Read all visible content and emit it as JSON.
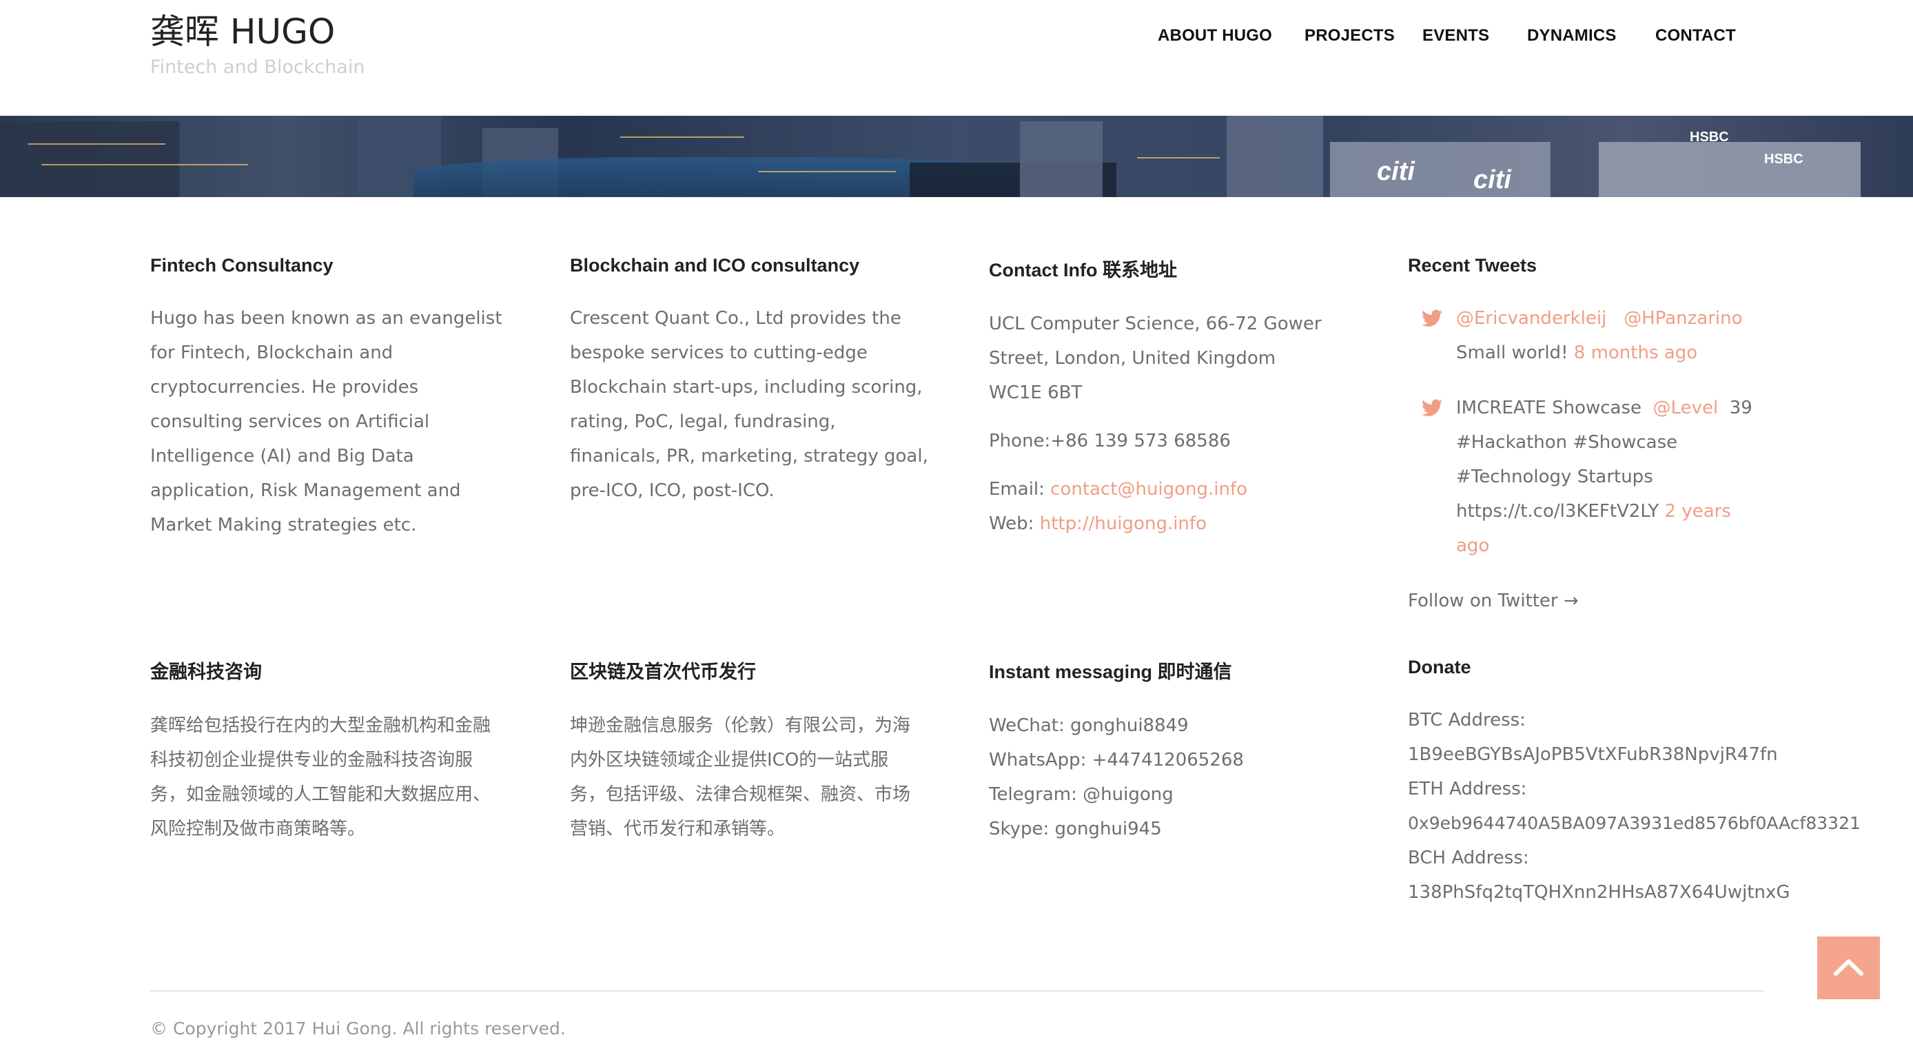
{
  "site": {
    "title": "龚晖 HUGO",
    "tagline": "Fintech and Blockchain"
  },
  "nav": {
    "items": [
      "ABOUT HUGO",
      "PROJECTS",
      "EVENTS",
      "DYNAMICS",
      "CONTACT"
    ]
  },
  "hero": {
    "signs": [
      "citi",
      "citi",
      "HSBC",
      "HSBC"
    ]
  },
  "fintech": {
    "heading": "Fintech Consultancy",
    "body": "Hugo has been known as an evangelist for Fintech, Blockchain and cryptocurrencies. He provides consulting services on Artificial Intelligence (AI) and Big Data application, Risk Management and Market Making strategies etc."
  },
  "blockchain": {
    "heading": "Blockchain and ICO consultancy",
    "body": "Crescent Quant Co., Ltd provides the bespoke services to cutting-edge Blockchain start-ups, including scoring, rating, PoC, legal, fundrasing, finanicals, PR, marketing, strategy goal, pre-ICO, ICO, post-ICO."
  },
  "contact": {
    "heading": "Contact Info 联系地址",
    "address": "UCL Computer Science, 66-72 Gower Street, London, United Kingdom WC1E 6BT",
    "phone": "Phone:+86 139 573 68586",
    "email_label": "Email: ",
    "email": "contact@huigong.info",
    "web_label": "Web: ",
    "web": "http://huigong.info"
  },
  "tweets": {
    "heading": "Recent Tweets",
    "items": [
      {
        "mention1": "@Ericvanderkleij",
        "mention2": "@HPanzarino",
        "text": "Small world!",
        "time": "8 months ago"
      },
      {
        "pre": "IMCREATE Showcase",
        "mention": "@Level",
        "text": "39 #Hackathon #Showcase #Technology Startups https://t.co/l3KEFtV2LY",
        "time": "2 years ago"
      }
    ],
    "follow": "Follow on Twitter →"
  },
  "fintech_cn": {
    "heading": "金融科技咨询",
    "body": "龚晖给包括投行在内的大型金融机构和金融科技初创企业提供专业的金融科技咨询服务，如金融领域的人工智能和大数据应用、风险控制及做市商策略等。"
  },
  "blockchain_cn": {
    "heading": "区块链及首次代币发行",
    "body": "坤逊金融信息服务（伦敦）有限公司，为海内外区块链领域企业提供ICO的一站式服务，包括评级、法律合规框架、融资、市场营销、代币发行和承销等。"
  },
  "im": {
    "heading": "Instant messaging 即时通信",
    "items": [
      "WeChat: gonghui8849",
      "WhatsApp: +447412065268",
      "Telegram: @huigong",
      "Skype: gonghui945"
    ]
  },
  "donate": {
    "heading": "Donate",
    "btc_label": "BTC Address:",
    "btc": "1B9eeBGYBsAJoPB5VtXFubR38NpvjR47fn",
    "eth_label": "ETH Address:",
    "eth": "0x9eb9644740A5BA097A3931ed8576bf0AAcf83321",
    "bch_label": "BCH Address:",
    "bch": "138PhSfq2tqTQHXnn2HHsA87X64UwjtnxG"
  },
  "footer": {
    "copyright": "© Copyright 2017 Hui Gong. All rights reserved."
  },
  "colors": {
    "accent": "#ef9e85",
    "back_to_top": "#f5a58e"
  },
  "icons": {
    "tweet": "twitter-bird-icon",
    "back_to_top": "chevron-up-icon"
  }
}
